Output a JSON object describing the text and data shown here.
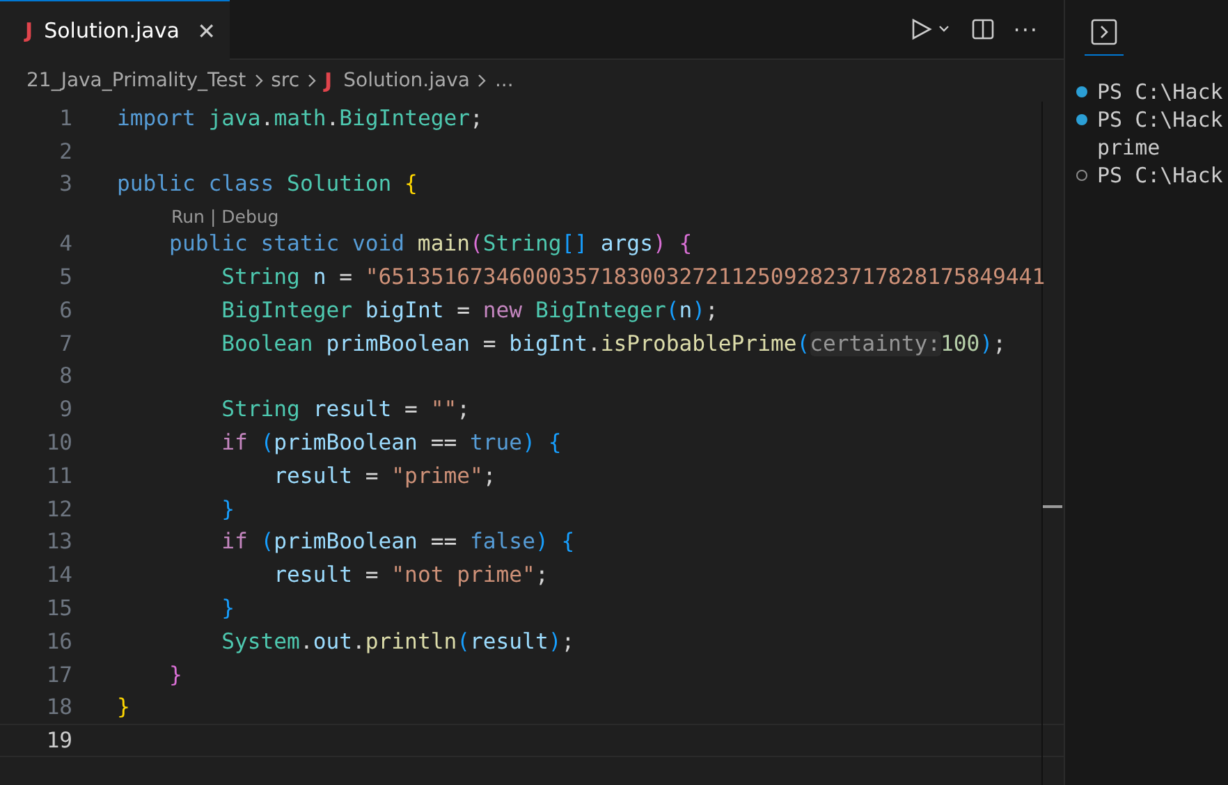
{
  "tabs": [
    {
      "icon": "J",
      "label": "Solution.java",
      "selected": true,
      "close": "✕"
    }
  ],
  "actions": {
    "more": "···"
  },
  "breadcrumb": [
    {
      "label": "21_Java_Primality_Test"
    },
    {
      "label": "src"
    },
    {
      "icon": "J",
      "label": "Solution.java"
    },
    {
      "label": "..."
    }
  ],
  "lines": [
    {
      "number": "1",
      "current": false,
      "tokens": [
        {
          "kind": "keyword",
          "text": "import"
        },
        {
          "kind": "type",
          "text": " java"
        },
        {
          "kind": "plain",
          "text": "."
        },
        {
          "kind": "type",
          "text": "math"
        },
        {
          "kind": "plain",
          "text": "."
        },
        {
          "kind": "type",
          "text": "BigInteger"
        },
        {
          "kind": "plain",
          "text": ";"
        }
      ]
    },
    {
      "number": "2",
      "current": false
    },
    {
      "number": "3",
      "current": false,
      "tokens": [
        {
          "kind": "keyword",
          "text": "public class"
        },
        {
          "kind": "type",
          "text": " Solution"
        },
        {
          "kind": "bracket1",
          "text": " {"
        }
      ]
    },
    {
      "number": "4",
      "current": false,
      "lens": "Run | Debug",
      "tokens": [
        {
          "kind": "keyword",
          "text": "    public static void"
        },
        {
          "kind": "func",
          "text": " main"
        },
        {
          "kind": "bracket2",
          "text": "("
        },
        {
          "kind": "type",
          "text": "String"
        },
        {
          "kind": "bracket3",
          "text": "[]"
        },
        {
          "kind": "var",
          "text": " args"
        },
        {
          "kind": "bracket2",
          "text": ")"
        },
        {
          "kind": "bracket2",
          "text": " {"
        }
      ]
    },
    {
      "number": "5",
      "current": false,
      "tokens": [
        {
          "kind": "type",
          "text": "        String"
        },
        {
          "kind": "var",
          "text": " n"
        },
        {
          "kind": "plain",
          "text": " = "
        },
        {
          "kind": "string",
          "text": "\"651351673460003571830032721125092823717828175849441"
        }
      ]
    },
    {
      "number": "6",
      "current": false,
      "tokens": [
        {
          "kind": "type",
          "text": "        BigInteger"
        },
        {
          "kind": "var",
          "text": " bigInt"
        },
        {
          "kind": "plain",
          "text": " = "
        },
        {
          "kind": "control",
          "text": "new"
        },
        {
          "kind": "type",
          "text": " BigInteger"
        },
        {
          "kind": "bracket3",
          "text": "("
        },
        {
          "kind": "var",
          "text": "n"
        },
        {
          "kind": "bracket3",
          "text": ")"
        },
        {
          "kind": "plain",
          "text": ";"
        }
      ]
    },
    {
      "number": "7",
      "current": false,
      "tokens": [
        {
          "kind": "type",
          "text": "        Boolean"
        },
        {
          "kind": "var",
          "text": " primBoolean"
        },
        {
          "kind": "plain",
          "text": " = "
        },
        {
          "kind": "var",
          "text": "bigInt"
        },
        {
          "kind": "plain",
          "text": "."
        },
        {
          "kind": "func",
          "text": "isProbablePrime"
        },
        {
          "kind": "bracket3",
          "text": "("
        },
        {
          "kind": "hint",
          "text": "certainty:"
        },
        {
          "kind": "number",
          "text": "100"
        },
        {
          "kind": "bracket3",
          "text": ")"
        },
        {
          "kind": "plain",
          "text": ";"
        }
      ]
    },
    {
      "number": "8",
      "current": false
    },
    {
      "number": "9",
      "current": false,
      "tokens": [
        {
          "kind": "type",
          "text": "        String"
        },
        {
          "kind": "var",
          "text": " result"
        },
        {
          "kind": "plain",
          "text": " = "
        },
        {
          "kind": "string",
          "text": "\"\""
        },
        {
          "kind": "plain",
          "text": ";"
        }
      ]
    },
    {
      "number": "10",
      "current": false,
      "tokens": [
        {
          "kind": "control",
          "text": "        if"
        },
        {
          "kind": "bracket3",
          "text": " ("
        },
        {
          "kind": "var",
          "text": "primBoolean"
        },
        {
          "kind": "plain",
          "text": " == "
        },
        {
          "kind": "keyword",
          "text": "true"
        },
        {
          "kind": "bracket3",
          "text": ")"
        },
        {
          "kind": "bracket3",
          "text": " {"
        }
      ]
    },
    {
      "number": "11",
      "current": false,
      "tokens": [
        {
          "kind": "var",
          "text": "            result"
        },
        {
          "kind": "plain",
          "text": " = "
        },
        {
          "kind": "string",
          "text": "\"prime\""
        },
        {
          "kind": "plain",
          "text": ";"
        }
      ]
    },
    {
      "number": "12",
      "current": false,
      "tokens": [
        {
          "kind": "bracket3",
          "text": "        }"
        }
      ]
    },
    {
      "number": "13",
      "current": false,
      "tokens": [
        {
          "kind": "control",
          "text": "        if"
        },
        {
          "kind": "bracket3",
          "text": " ("
        },
        {
          "kind": "var",
          "text": "primBoolean"
        },
        {
          "kind": "plain",
          "text": " == "
        },
        {
          "kind": "keyword",
          "text": "false"
        },
        {
          "kind": "bracket3",
          "text": ")"
        },
        {
          "kind": "bracket3",
          "text": " {"
        }
      ]
    },
    {
      "number": "14",
      "current": false,
      "tokens": [
        {
          "kind": "var",
          "text": "            result"
        },
        {
          "kind": "plain",
          "text": " = "
        },
        {
          "kind": "string",
          "text": "\"not prime\""
        },
        {
          "kind": "plain",
          "text": ";"
        }
      ]
    },
    {
      "number": "15",
      "current": false,
      "tokens": [
        {
          "kind": "bracket3",
          "text": "        }"
        }
      ]
    },
    {
      "number": "16",
      "current": false,
      "tokens": [
        {
          "kind": "type",
          "text": "        System"
        },
        {
          "kind": "plain",
          "text": "."
        },
        {
          "kind": "var",
          "text": "out"
        },
        {
          "kind": "plain",
          "text": "."
        },
        {
          "kind": "func",
          "text": "println"
        },
        {
          "kind": "bracket3",
          "text": "("
        },
        {
          "kind": "var",
          "text": "result"
        },
        {
          "kind": "bracket3",
          "text": ")"
        },
        {
          "kind": "plain",
          "text": ";"
        }
      ]
    },
    {
      "number": "17",
      "current": false,
      "tokens": [
        {
          "kind": "bracket2",
          "text": "    }"
        }
      ]
    },
    {
      "number": "18",
      "current": false,
      "tokens": [
        {
          "kind": "bracket1",
          "text": "}"
        }
      ]
    },
    {
      "number": "19",
      "current": true
    }
  ],
  "terminal": {
    "lines": [
      {
        "decorated": true,
        "succeeded": true,
        "text": "PS C:\\Hack"
      },
      {
        "decorated": true,
        "succeeded": true,
        "text": "PS C:\\Hack"
      },
      {
        "decorated": false,
        "text": "prime"
      },
      {
        "decorated": true,
        "succeeded": false,
        "text": "PS C:\\Hack"
      }
    ]
  }
}
